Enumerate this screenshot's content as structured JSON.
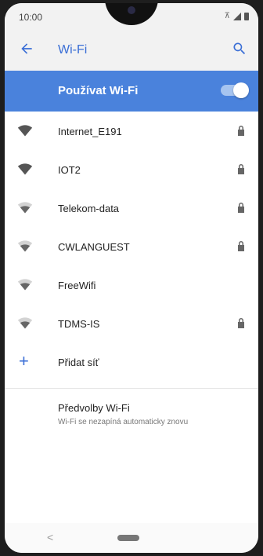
{
  "status_bar": {
    "time": "10:00"
  },
  "app_bar": {
    "title": "Wi-Fi",
    "back_icon": "arrow-back-icon",
    "search_icon": "search-icon"
  },
  "colors": {
    "accent": "#3b6fd6",
    "banner": "#4a82dc",
    "wifi_full": "#555555",
    "wifi_weak": "#9e9e9e"
  },
  "wifi_switch": {
    "label": "Používat Wi-Fi",
    "enabled": true
  },
  "networks": [
    {
      "name": "Internet_E191",
      "locked": true,
      "signal": "full"
    },
    {
      "name": "IOT2",
      "locked": true,
      "signal": "full"
    },
    {
      "name": "Telekom-data",
      "locked": true,
      "signal": "medium"
    },
    {
      "name": "CWLANGUEST",
      "locked": true,
      "signal": "medium"
    },
    {
      "name": "FreeWifi",
      "locked": false,
      "signal": "medium"
    },
    {
      "name": "TDMS-IS",
      "locked": true,
      "signal": "medium"
    }
  ],
  "add_network": {
    "label": "Přidat síť",
    "icon": "plus-icon"
  },
  "preferences": {
    "title": "Předvolby Wi-Fi",
    "subtitle": "Wi-Fi se nezapíná automaticky znovu"
  },
  "nav": {
    "back_icon": "nav-back-icon",
    "home_icon": "nav-home-pill"
  }
}
